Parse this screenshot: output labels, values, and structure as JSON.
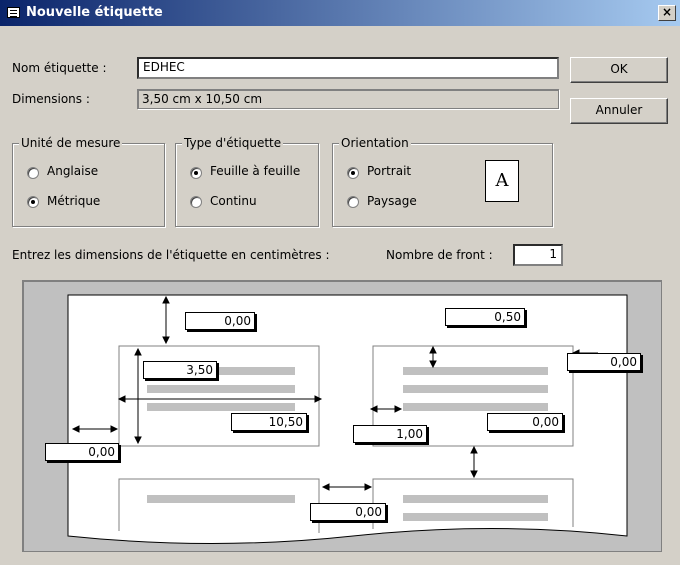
{
  "title": "Nouvelle étiquette",
  "close_label": "×",
  "name_label": "Nom étiquette :",
  "name_value": "EDHEC",
  "dimensions_label": "Dimensions :",
  "dimensions_value": "3,50 cm x 10,50 cm",
  "ok_label": "OK",
  "cancel_label": "Annuler",
  "unit_group": {
    "title": "Unité de mesure",
    "options": [
      {
        "label": "Anglaise",
        "selected": false
      },
      {
        "label": "Métrique",
        "selected": true
      }
    ]
  },
  "type_group": {
    "title": "Type d'étiquette",
    "options": [
      {
        "label": "Feuille à feuille",
        "selected": true
      },
      {
        "label": "Continu",
        "selected": false
      }
    ]
  },
  "orient_group": {
    "title": "Orientation",
    "options": [
      {
        "label": "Portrait",
        "selected": true
      },
      {
        "label": "Paysage",
        "selected": false
      }
    ],
    "preview_letter": "A"
  },
  "instructions": "Entrez les dimensions de l'étiquette en centimètres :",
  "front_label": "Nombre de front :",
  "front_value": "1",
  "preview": {
    "top_margin": "0,00",
    "height": "3,50",
    "width": "10,50",
    "left_margin": "0,00",
    "right_margin": "0,00",
    "vert_spacing": "0,50",
    "horiz_spacing": "0,00",
    "indent": "1,00",
    "right_inner": "0,00"
  }
}
